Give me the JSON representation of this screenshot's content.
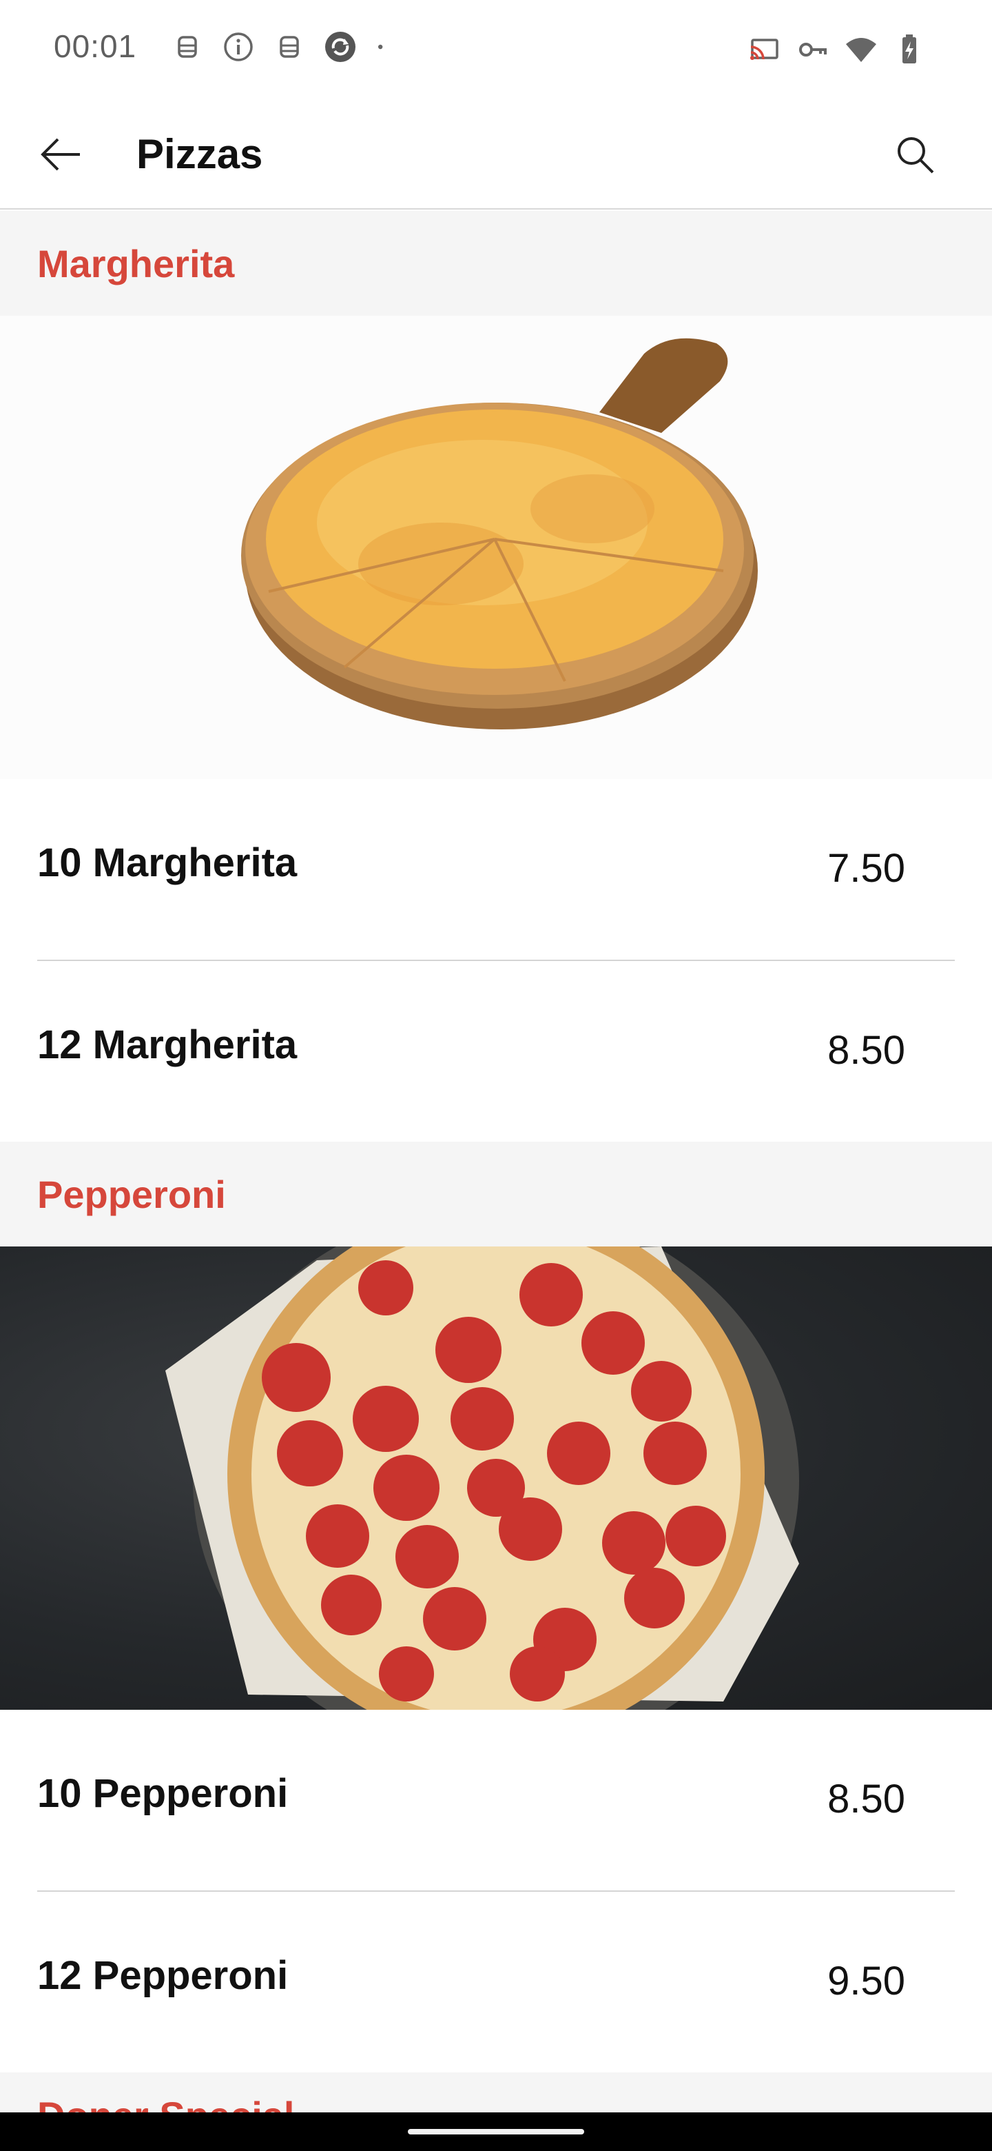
{
  "status_bar": {
    "time": "00:01",
    "left_icons": [
      "robot-icon",
      "info-icon",
      "robot-icon",
      "sync-icon",
      "dot-icon"
    ],
    "right_icons": [
      "cast-icon",
      "vpn-key-icon",
      "wifi-icon",
      "battery-charging-icon"
    ]
  },
  "app_bar": {
    "title": "Pizzas",
    "back_icon": "arrow-back-icon",
    "search_icon": "search-icon"
  },
  "sections": [
    {
      "title": "Margherita",
      "image": "margherita-pizza-image",
      "items": [
        {
          "name": "10 Margherita",
          "price": "7.50"
        },
        {
          "name": "12 Margherita",
          "price": "8.50"
        }
      ]
    },
    {
      "title": "Pepperoni",
      "image": "pepperoni-pizza-image",
      "items": [
        {
          "name": "10 Pepperoni",
          "price": "8.50"
        },
        {
          "name": "12 Pepperoni",
          "price": "9.50"
        }
      ]
    },
    {
      "title": "Doner Special"
    }
  ],
  "colors": {
    "accent": "#d6473b",
    "section_bg": "#f5f5f5",
    "nav_bar": "#000000"
  }
}
